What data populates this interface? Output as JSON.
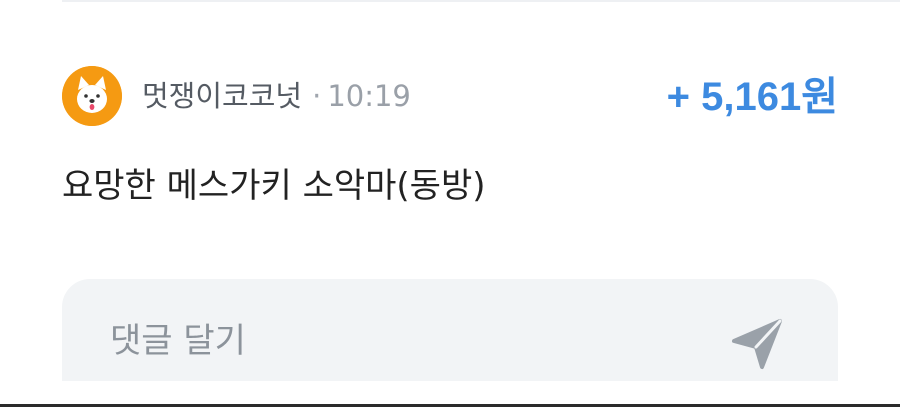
{
  "post": {
    "author": "멋쟁이코코넛",
    "separator": "·",
    "time": "10:19",
    "amount": "+ 5,161원",
    "message": "요망한 메스가키 소악마(동방)"
  },
  "comment": {
    "placeholder": "댓글 달기"
  },
  "icons": {
    "avatar": "dog-avatar-icon",
    "send": "send-paper-plane-icon"
  },
  "colors": {
    "amount": "#3d8ae0",
    "avatar_bg": "#f59a12",
    "comment_bg": "#f2f4f6"
  }
}
